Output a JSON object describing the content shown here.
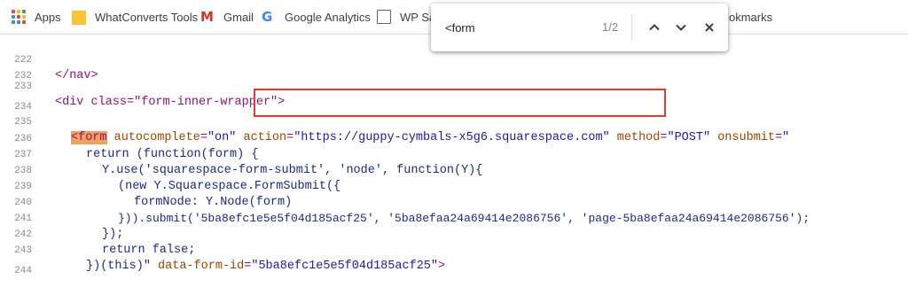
{
  "bookmarks": [
    {
      "label": "Apps",
      "icon": "apps-grid-icon"
    },
    {
      "label": "WhatConverts Tools",
      "icon": "folder-icon"
    },
    {
      "label": "Gmail",
      "icon": "gmail-icon"
    },
    {
      "label": "Google Analytics",
      "icon": "google-icon"
    },
    {
      "label": "WP Sa",
      "icon": "page-icon"
    },
    {
      "label": "okmarks",
      "icon": ""
    }
  ],
  "find": {
    "query": "<form",
    "count": "1/2",
    "prev_icon": "chevron-up-icon",
    "next_icon": "chevron-down-icon",
    "close_icon": "close-icon"
  },
  "source": {
    "lines": [
      {
        "n": "222",
        "text": "</nav>"
      },
      {
        "n": "232",
        "text": ""
      },
      {
        "n": "233",
        "text": "<div class=\"form-inner-wrapper\">"
      },
      {
        "n": "234",
        "text": ""
      },
      {
        "n": "235",
        "text": "<form autocomplete=\"on\" action=\"https://guppy-cymbals-x5g6.squarespace.com\" method=\"POST\" onsubmit=\""
      },
      {
        "n": "236",
        "text": "return (function(form) {"
      },
      {
        "n": "237",
        "text": "Y.use('squarespace-form-submit', 'node', function(Y){"
      },
      {
        "n": "238",
        "text": "(new Y.Squarespace.FormSubmit({"
      },
      {
        "n": "239",
        "text": "formNode: Y.Node(form)"
      },
      {
        "n": "240",
        "text": "})).submit('5ba8efc1e5e5f04d185acf25', '5ba8efaa24a69414e2086756', 'page-5ba8efaa24a69414e2086756');"
      },
      {
        "n": "241",
        "text": "});"
      },
      {
        "n": "242",
        "text": "return false;"
      },
      {
        "n": "243",
        "text": "})(this)\" data-form-id=\"5ba8efc1e5e5f04d185acf25\">"
      },
      {
        "n": "244",
        "text": ""
      }
    ]
  },
  "colors": {
    "tag": "#881280",
    "attr": "#994500",
    "value": "#1a1aa6",
    "match_highlight": "#f5a05a",
    "annotation_box": "#e53935"
  }
}
